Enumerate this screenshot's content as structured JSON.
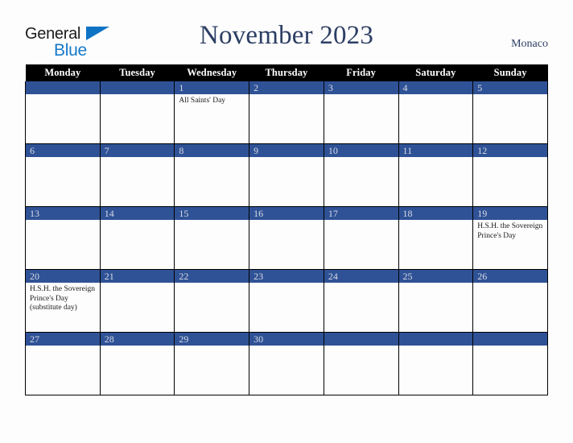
{
  "brand": {
    "name_part1": "General",
    "name_part2": "Blue",
    "triangle_icon": "triangle-icon",
    "accent_color": "#1579c9"
  },
  "header": {
    "title": "November 2023",
    "location": "Monaco"
  },
  "theme": {
    "header_bar_color": "#000000",
    "date_strip_color": "#2f5296",
    "title_color": "#2c3e63",
    "page_background": "#fdfdfd",
    "cell_background": "#fdfdfd",
    "border_color": "#000000"
  },
  "calendar": {
    "weekday_headers": [
      "Monday",
      "Tuesday",
      "Wednesday",
      "Thursday",
      "Friday",
      "Saturday",
      "Sunday"
    ],
    "weeks": [
      [
        {
          "day": "",
          "events": []
        },
        {
          "day": "",
          "events": []
        },
        {
          "day": "1",
          "events": [
            "All Saints' Day"
          ]
        },
        {
          "day": "2",
          "events": []
        },
        {
          "day": "3",
          "events": []
        },
        {
          "day": "4",
          "events": []
        },
        {
          "day": "5",
          "events": []
        }
      ],
      [
        {
          "day": "6",
          "events": []
        },
        {
          "day": "7",
          "events": []
        },
        {
          "day": "8",
          "events": []
        },
        {
          "day": "9",
          "events": []
        },
        {
          "day": "10",
          "events": []
        },
        {
          "day": "11",
          "events": []
        },
        {
          "day": "12",
          "events": []
        }
      ],
      [
        {
          "day": "13",
          "events": []
        },
        {
          "day": "14",
          "events": []
        },
        {
          "day": "15",
          "events": []
        },
        {
          "day": "16",
          "events": []
        },
        {
          "day": "17",
          "events": []
        },
        {
          "day": "18",
          "events": []
        },
        {
          "day": "19",
          "events": [
            "H.S.H. the Sovereign Prince's Day"
          ]
        }
      ],
      [
        {
          "day": "20",
          "events": [
            "H.S.H. the Sovereign Prince's Day (substitute day)"
          ]
        },
        {
          "day": "21",
          "events": []
        },
        {
          "day": "22",
          "events": []
        },
        {
          "day": "23",
          "events": []
        },
        {
          "day": "24",
          "events": []
        },
        {
          "day": "25",
          "events": []
        },
        {
          "day": "26",
          "events": []
        }
      ],
      [
        {
          "day": "27",
          "events": []
        },
        {
          "day": "28",
          "events": []
        },
        {
          "day": "29",
          "events": []
        },
        {
          "day": "30",
          "events": []
        },
        {
          "day": "",
          "events": []
        },
        {
          "day": "",
          "events": []
        },
        {
          "day": "",
          "events": []
        }
      ]
    ]
  }
}
